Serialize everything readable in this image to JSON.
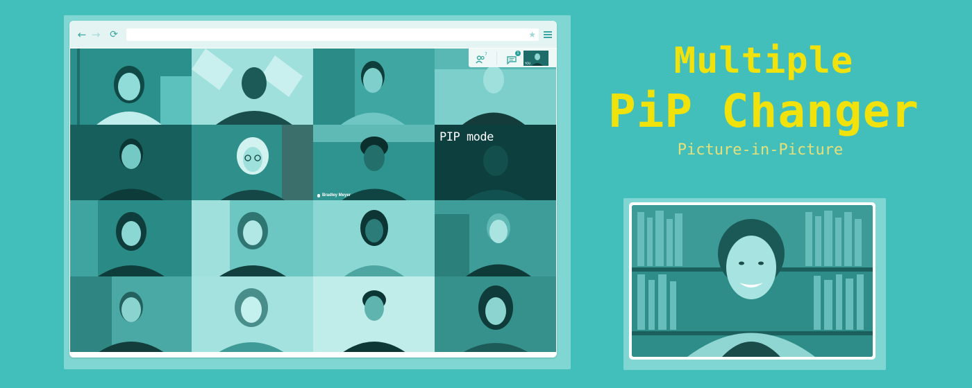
{
  "browser": {
    "back_icon": "←",
    "forward_icon": "→",
    "reload_icon": "⟳",
    "star_icon": "★"
  },
  "meet": {
    "participants_count": "7",
    "chat_badge": "1",
    "self_label": "YOU"
  },
  "grid": {
    "pip_tile_label": "PIP mode",
    "name_tag": "Bradley Meyer"
  },
  "hero": {
    "title_line1": "Multiple",
    "title_line2": "PiP Changer",
    "subtitle": "Picture-in-Picture"
  },
  "colors": {
    "background": "#43bfbb",
    "title_yellow": "#f2e20c",
    "subtitle_yellow": "#e6e07a",
    "tile_dark": "#0c3f3d"
  }
}
